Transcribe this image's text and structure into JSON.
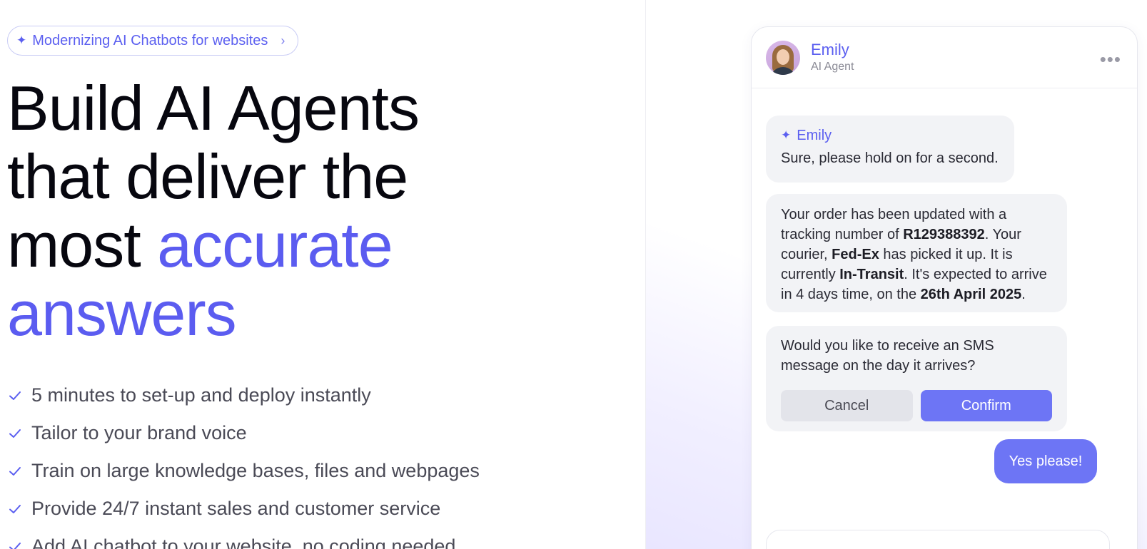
{
  "hero": {
    "pill": {
      "icon": "sparkle-icon",
      "label": "Modernizing AI Chatbots for websites",
      "chevron": "›"
    },
    "headline": {
      "line1": "Build AI Agents",
      "line2": "that deliver the",
      "line3_plain": "most ",
      "line3_accent": "accurate",
      "line4_accent": "answers"
    },
    "features": [
      "5 minutes to set-up and deploy instantly",
      "Tailor to your brand voice",
      "Train on large knowledge bases, files and webpages",
      "Provide 24/7 instant sales and customer service",
      "Add AI chatbot to your website, no coding needed"
    ]
  },
  "chat": {
    "agent": {
      "name": "Emily",
      "role": "AI Agent"
    },
    "menu_icon": "more-horizontal-icon",
    "messages": {
      "m1": {
        "sender": "Emily",
        "text": "Sure, please hold on for a second."
      },
      "m2": {
        "t1": "Your order has been updated with a tracking number of ",
        "tracking": "R129388392",
        "t2": ". Your courier, ",
        "courier": "Fed-Ex",
        "t3": " has picked it up. It is currently ",
        "status": "In-Transit",
        "t4": ". It's expected to arrive in 4 days time, on the ",
        "date": "26th April 2025",
        "t5": "."
      },
      "m3": {
        "text": "Would you like to receive an SMS message on the day it arrives?",
        "cancel_label": "Cancel",
        "confirm_label": "Confirm"
      },
      "user_reply": "Yes please!"
    }
  },
  "colors": {
    "accent": "#5b5cf0",
    "button_primary": "#6d75f5",
    "bubble_bg": "#f2f3f6"
  }
}
